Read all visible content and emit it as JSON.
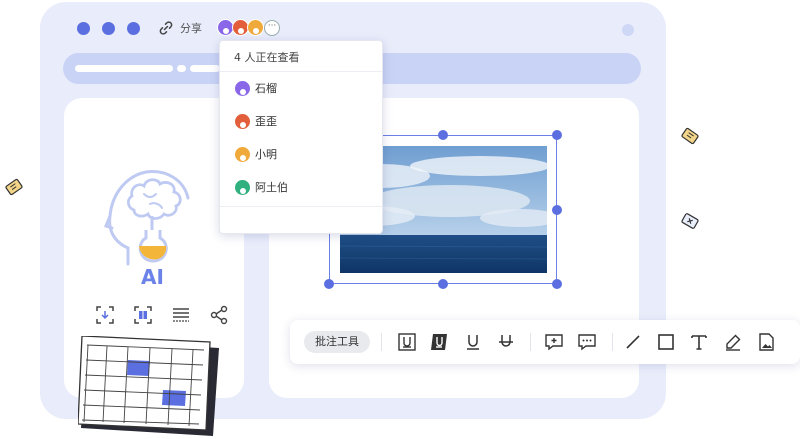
{
  "toolbar_top": {
    "share_label": "分享",
    "viewers_more": "···"
  },
  "viewers": {
    "title": "4 人正在查看",
    "items": [
      {
        "name": "石榴",
        "color": "#8a67e8"
      },
      {
        "name": "歪歪",
        "color": "#e35f3c"
      },
      {
        "name": "小明",
        "color": "#f0a93b"
      },
      {
        "name": "阿土伯",
        "color": "#2fb07e"
      }
    ]
  },
  "ai_logo": {
    "label": "AI"
  },
  "annotation_toolbar": {
    "label": "批注工具",
    "tools": [
      "underline-box-icon",
      "underline-filled-icon",
      "underline-icon",
      "strikethrough-icon",
      "add-comment-icon",
      "comment-icon",
      "line-icon",
      "rectangle-icon",
      "text-icon",
      "pen-icon",
      "image-icon"
    ]
  },
  "colors": {
    "accent": "#5b6fe0",
    "window_bg": "#e9edfb",
    "url_bar": "#c9d3f5"
  }
}
